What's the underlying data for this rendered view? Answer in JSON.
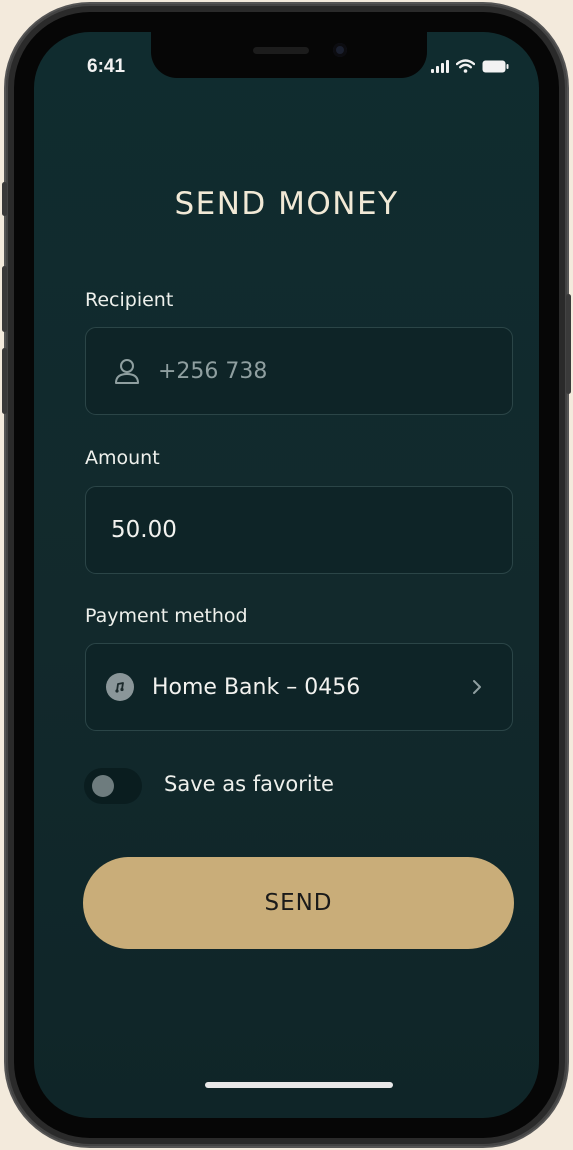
{
  "status_bar": {
    "time": "6:41"
  },
  "header": {
    "title": "SEND MONEY"
  },
  "recipient": {
    "label": "Recipient",
    "value": "+256 738"
  },
  "amount": {
    "label": "Amount",
    "value": "50.00"
  },
  "payment_method": {
    "label": "Payment method",
    "value": "Home Bank – 0456"
  },
  "favorite": {
    "label": "Save as favorite",
    "enabled": false
  },
  "actions": {
    "send_label": "SEND"
  },
  "colors": {
    "background": "#12292c",
    "field_background": "#0e2427",
    "accent": "#c9ad79",
    "title_text": "#f1e9d6"
  },
  "icons": {
    "recipient": "person-icon",
    "payment": "bank-icon",
    "payment_open": "chevron-right-icon"
  }
}
